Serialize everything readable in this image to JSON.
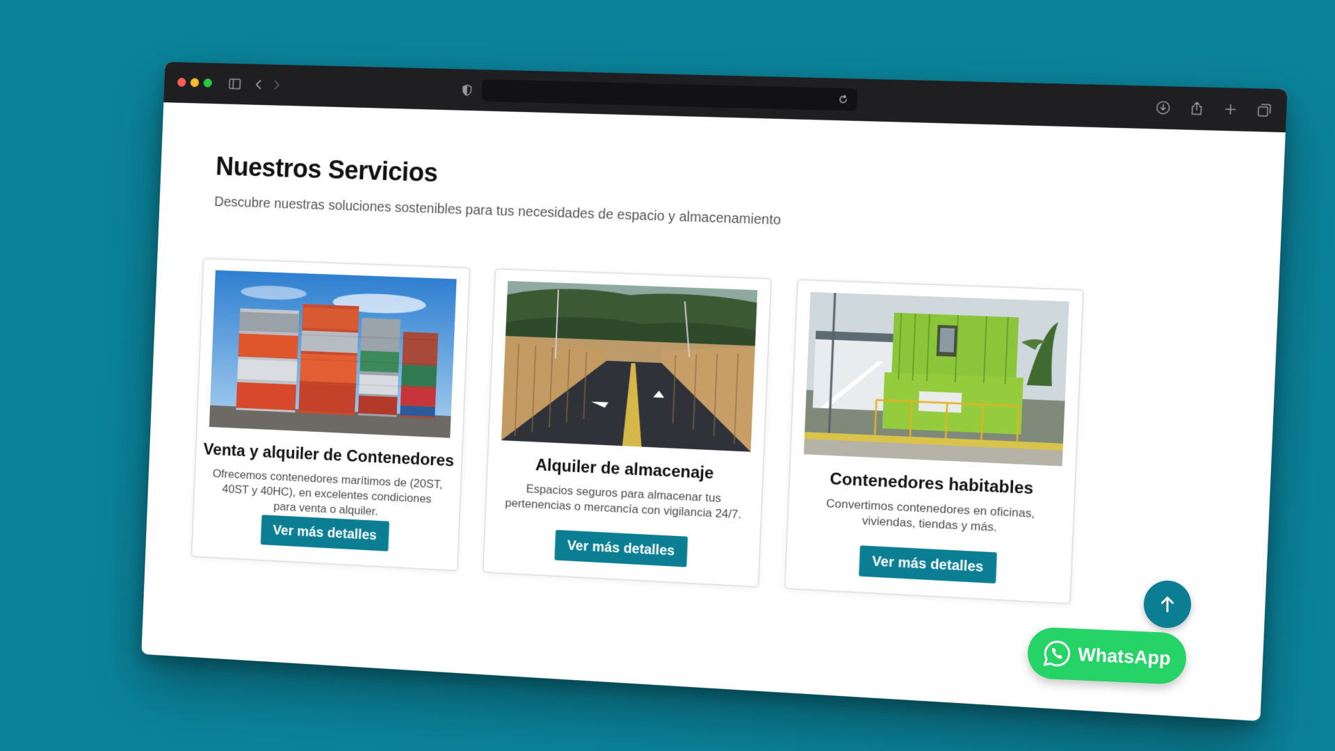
{
  "browser": {
    "traffic_lights": [
      "close",
      "minimize",
      "zoom"
    ],
    "icons": [
      "sidebar-icon",
      "back-icon",
      "forward-icon",
      "shield-icon",
      "reload-icon",
      "download-icon",
      "share-icon",
      "new-tab-icon",
      "tabs-overview-icon"
    ],
    "address_value": ""
  },
  "section": {
    "title": "Nuestros Servicios",
    "subtitle": "Descubre nuestras soluciones sostenibles para tus necesidades de espacio y almacenamiento"
  },
  "cards": [
    {
      "title": "Venta y alquiler de Contenedores",
      "description": "Ofrecemos contenedores marítimos de (20ST, 40ST y 40HC), en excelentes condiciones para venta o alquiler.",
      "button": "Ver más detalles"
    },
    {
      "title": "Alquiler de almacenaje",
      "description": "Espacios seguros para almacenar tus pertenencias o mercancía con vigilancia 24/7.",
      "button": "Ver más detalles"
    },
    {
      "title": "Contenedores habitables",
      "description": "Convertimos contenedores en oficinas, viviendas, tiendas y más.",
      "button": "Ver más detalles"
    }
  ],
  "floating": {
    "whatsapp_label": "WhatsApp",
    "back_to_top_icon": "arrow-up-icon"
  },
  "colors": {
    "background": "#0a8299",
    "accent": "#0b7e93",
    "whatsapp": "#25d366",
    "titlebar": "#1f1f21"
  }
}
